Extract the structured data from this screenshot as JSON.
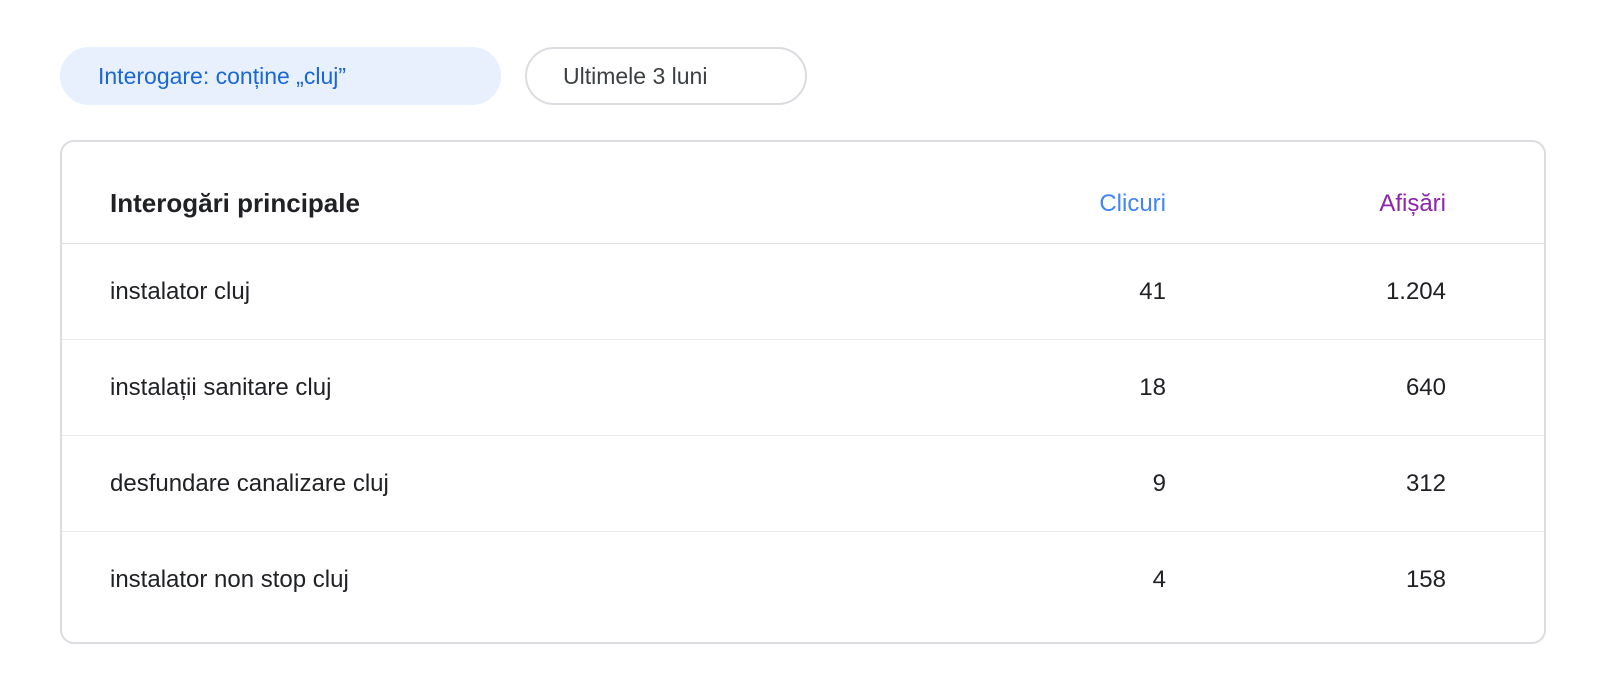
{
  "filters": {
    "query_chip": "Interogare: conține „cluj”",
    "date_chip": "Ultimele 3 luni"
  },
  "table": {
    "title": "Interogări principale",
    "columns": {
      "clicks": "Clicuri",
      "impressions": "Afișări"
    },
    "rows": [
      {
        "query": "instalator cluj",
        "clicks": "41",
        "impressions": "1.204"
      },
      {
        "query": "instalații sanitare cluj",
        "clicks": "18",
        "impressions": "640"
      },
      {
        "query": "desfundare canalizare cluj",
        "clicks": "9",
        "impressions": "312"
      },
      {
        "query": "instalator non stop cluj",
        "clicks": "4",
        "impressions": "158"
      }
    ]
  },
  "colors": {
    "query_chip_bg": "#e8f0fe",
    "query_chip_text": "#1967d2",
    "clicks_header": "#4285f4",
    "impressions_header": "#8e24aa"
  }
}
